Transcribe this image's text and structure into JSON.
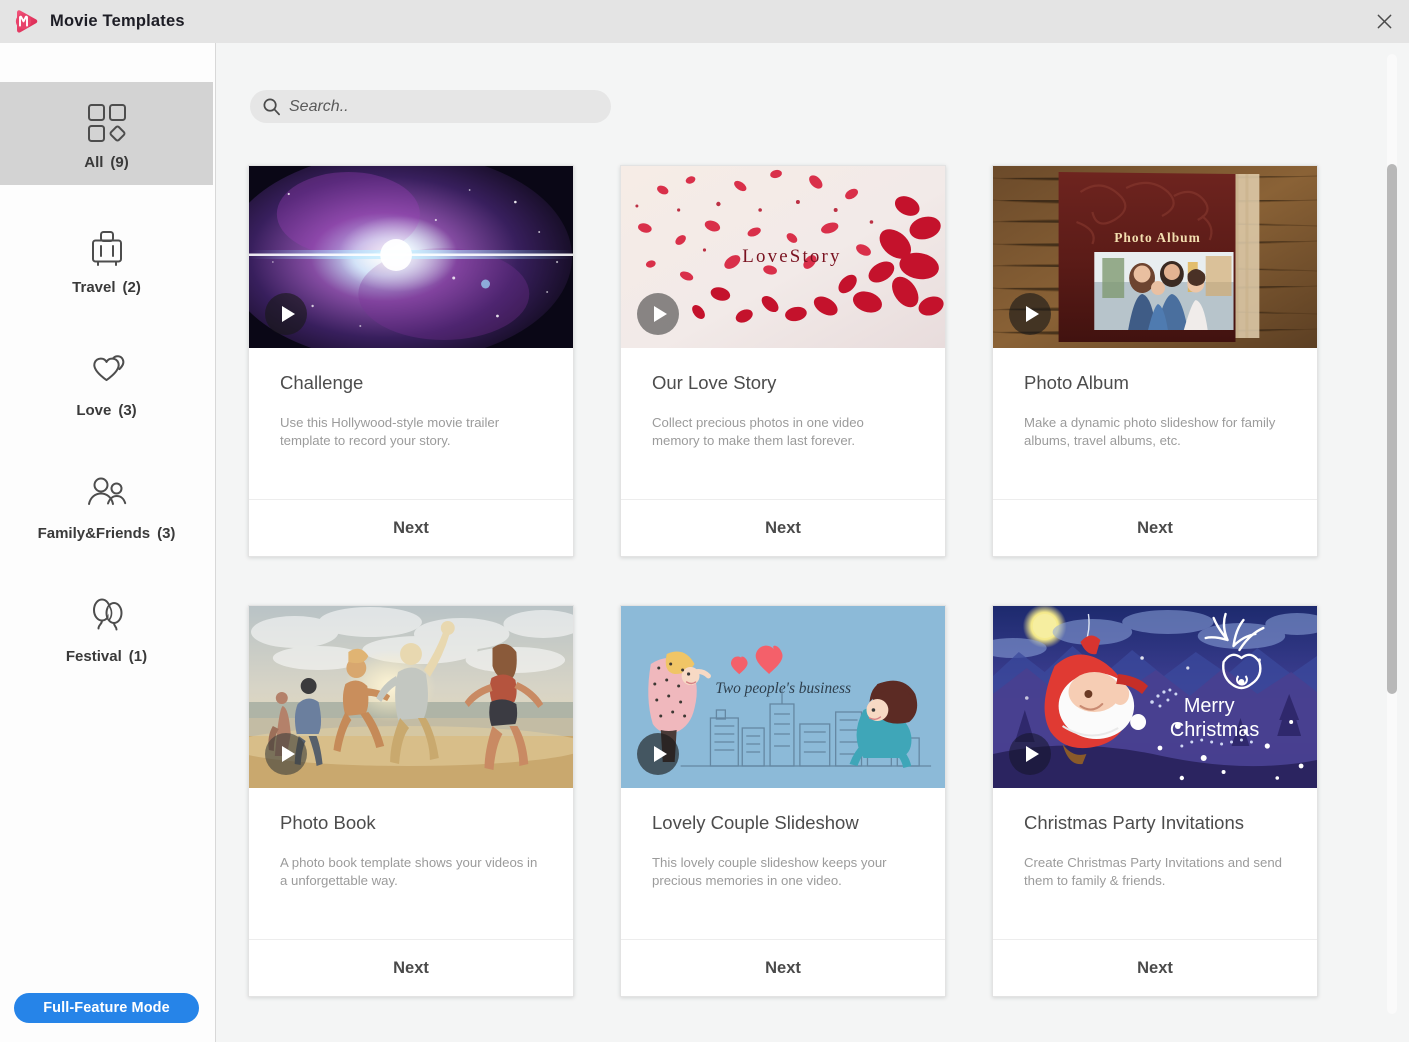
{
  "window": {
    "title": "Movie Templates",
    "logo_icon": "play-logo-icon",
    "close_icon": "close-icon"
  },
  "sidebar": {
    "items": [
      {
        "label": "All",
        "count": "(9)",
        "icon": "grid-squares-diamond-icon",
        "active": true
      },
      {
        "label": "Travel",
        "count": "(2)",
        "icon": "suitcase-icon",
        "active": false
      },
      {
        "label": "Love",
        "count": "(3)",
        "icon": "double-heart-icon",
        "active": false
      },
      {
        "label": "Family&Friends",
        "count": "(3)",
        "icon": "two-people-icon",
        "active": false
      },
      {
        "label": "Festival",
        "count": "(1)",
        "icon": "balloons-icon",
        "active": false
      }
    ],
    "full_feature_button": "Full-Feature Mode"
  },
  "search": {
    "placeholder": "Search..",
    "value": "",
    "icon": "search-icon"
  },
  "templates": [
    {
      "title": "Challenge",
      "description": "Use this Hollywood-style movie trailer template to record your story.",
      "next_label": "Next",
      "thumb": "space-nebula",
      "thumb_caption": ""
    },
    {
      "title": "Our Love Story",
      "description": "Collect precious photos in one video memory to make them last forever.",
      "next_label": "Next",
      "thumb": "rose-petals",
      "thumb_caption": "LoveStory"
    },
    {
      "title": "Photo Album",
      "description": "Make a dynamic photo slideshow for family albums, travel albums, etc.",
      "next_label": "Next",
      "thumb": "leather-album",
      "thumb_caption": "Photo Album"
    },
    {
      "title": "Photo Book",
      "description": "A photo book template shows your videos in a unforgettable way.",
      "next_label": "Next",
      "thumb": "beach-runners",
      "thumb_caption": ""
    },
    {
      "title": "Lovely Couple Slideshow",
      "description": "This lovely couple slideshow keeps your precious memories in one video.",
      "next_label": "Next",
      "thumb": "cartoon-couple",
      "thumb_caption": "Two people's business"
    },
    {
      "title": "Christmas Party Invitations",
      "description": "Create Christmas Party Invitations and send them to family & friends.",
      "next_label": "Next",
      "thumb": "christmas-night",
      "thumb_caption": "Merry Christmas"
    }
  ],
  "colors": {
    "accent_blue": "#2684e8",
    "logo_pink": "#e8436b",
    "titlebar": "#e4e4e4",
    "content_bg": "#f4f5f5"
  }
}
